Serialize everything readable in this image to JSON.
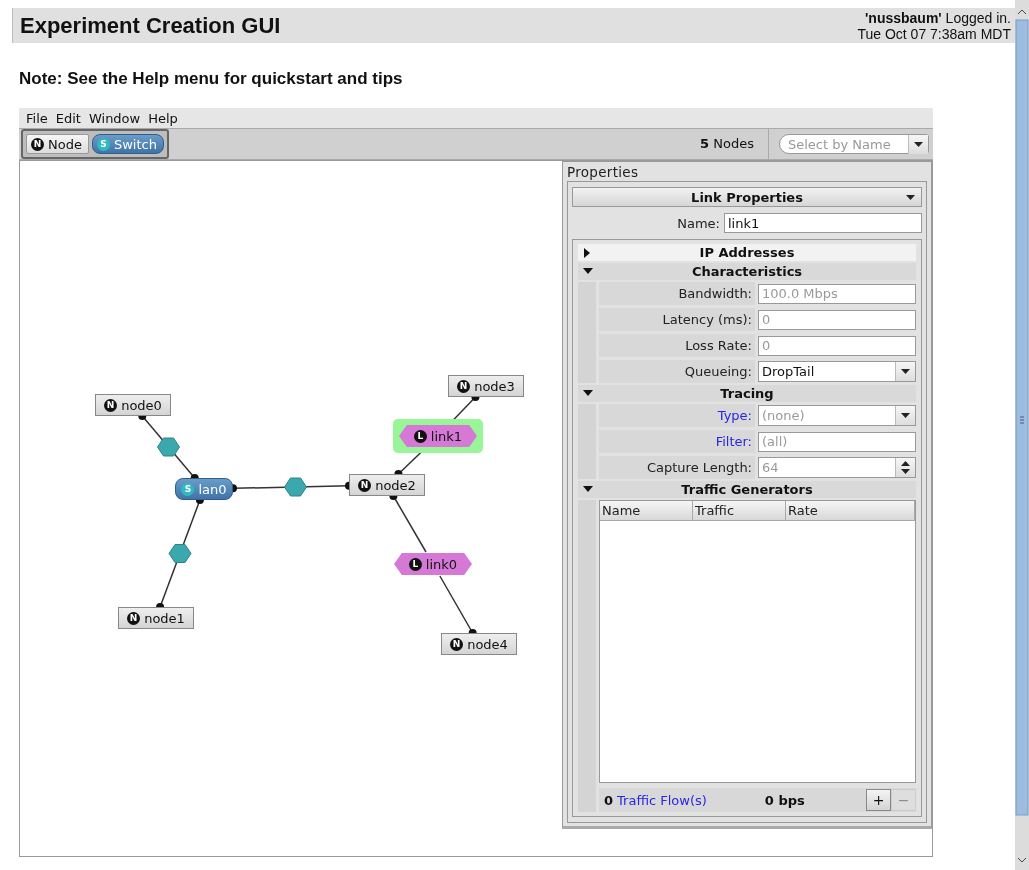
{
  "header": {
    "title": "Experiment Creation GUI",
    "login": "**'nussbaum'** Logged in.",
    "datetime": "Tue Oct 07 7:38am MDT"
  },
  "note": "Note: See the Help menu for quickstart and tips",
  "menu": [
    "File",
    "Edit",
    "Window",
    "Help"
  ],
  "tools": [
    {
      "label": "Node",
      "badge": "N",
      "kind": "node",
      "selected": false
    },
    {
      "label": "Switch",
      "badge": "S",
      "kind": "switch",
      "selected": true
    }
  ],
  "node_count": "**5** Nodes",
  "select_by_name": {
    "placeholder": "Select by Name"
  },
  "canvas": {
    "items": [
      {
        "label": "node0",
        "badge": "N",
        "kind": "node",
        "selected": false
      },
      {
        "label": "node1",
        "badge": "N",
        "kind": "node",
        "selected": false
      },
      {
        "label": "node2",
        "badge": "N",
        "kind": "node",
        "selected": false
      },
      {
        "label": "node3",
        "badge": "N",
        "kind": "node",
        "selected": false
      },
      {
        "label": "node4",
        "badge": "N",
        "kind": "node",
        "selected": false
      },
      {
        "label": "lan0",
        "badge": "S",
        "kind": "switch",
        "selected": false
      },
      {
        "label": "link1",
        "badge": "L",
        "kind": "link",
        "selected": true
      },
      {
        "label": "link0",
        "badge": "L",
        "kind": "link",
        "selected": false
      }
    ]
  },
  "properties": {
    "title": "Properties",
    "type_dropdown": "Link Properties",
    "name_label": "Name:",
    "name_value": "link1",
    "sections": [
      {
        "title": "IP Addresses",
        "expanded": false
      },
      {
        "kind": "fields",
        "title": "Characteristics",
        "expanded": true,
        "fields": [
          {
            "label": "Bandwidth:",
            "kind": "text",
            "placeholder": "100.0 Mbps",
            "link": false
          },
          {
            "label": "Latency (ms):",
            "kind": "text",
            "placeholder": "0",
            "link": false
          },
          {
            "label": "Loss Rate:",
            "kind": "text",
            "placeholder": "0",
            "link": false
          },
          {
            "label": "Queueing:",
            "kind": "select",
            "value": "DropTail",
            "link": false
          }
        ]
      },
      {
        "kind": "fields",
        "title": "Tracing",
        "expanded": true,
        "fields": [
          {
            "label": "Type:",
            "kind": "select",
            "placeholder": "(none)",
            "link": true
          },
          {
            "label": "Filter:",
            "kind": "text",
            "placeholder": "(all)",
            "link": true
          },
          {
            "label": "Capture Length:",
            "kind": "spinner",
            "placeholder": "64",
            "link": false
          }
        ]
      },
      {
        "kind": "table",
        "title": "Traffic Generators",
        "expanded": true,
        "columns": [
          "Name",
          "Traffic",
          "Rate"
        ],
        "footer": {
          "count": "0",
          "count_label": "Traffic Flow(s)",
          "rate": "0 bps"
        },
        "buttons": [
          {
            "label": "+",
            "disabled": false
          },
          {
            "label": "−",
            "disabled": true
          }
        ]
      }
    ]
  }
}
